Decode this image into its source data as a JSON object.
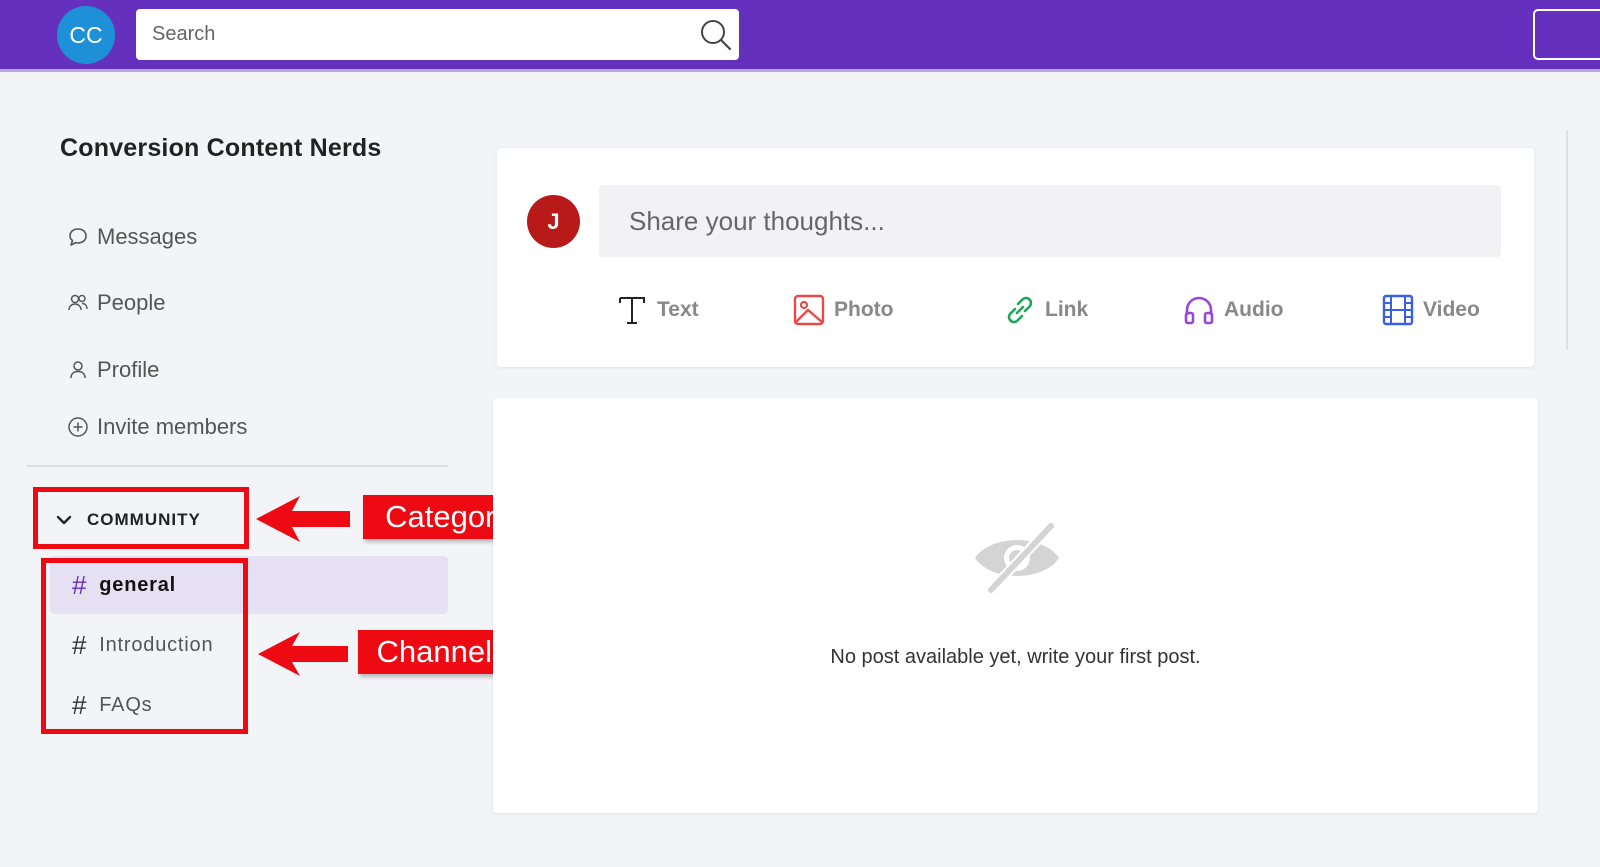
{
  "topbar": {
    "avatar_initials": "CC",
    "search_placeholder": "Search"
  },
  "sidebar": {
    "community_name": "Conversion Content Nerds",
    "nav": [
      {
        "label": "Messages",
        "icon": "chat-bubble-icon"
      },
      {
        "label": "People",
        "icon": "people-icon"
      },
      {
        "label": "Profile",
        "icon": "person-icon"
      },
      {
        "label": "Invite members",
        "icon": "plus-circle-icon"
      }
    ],
    "category": {
      "label": "COMMUNITY",
      "icon": "chevron-down-icon"
    },
    "channels": [
      {
        "label": "general",
        "active": true
      },
      {
        "label": "Introduction",
        "active": false
      },
      {
        "label": "FAQs",
        "active": false
      }
    ]
  },
  "annotations": {
    "category_label": "Category",
    "channels_label": "Channels",
    "color": "#ee0a12"
  },
  "composer": {
    "avatar_initial": "J",
    "placeholder": "Share your thoughts...",
    "post_types": [
      {
        "label": "Text",
        "icon": "text-t-icon",
        "color": "#222222"
      },
      {
        "label": "Photo",
        "icon": "image-icon",
        "color": "#e84a4a"
      },
      {
        "label": "Link",
        "icon": "link-icon",
        "color": "#22a55a"
      },
      {
        "label": "Audio",
        "icon": "headphones-icon",
        "color": "#9b45d8"
      },
      {
        "label": "Video",
        "icon": "film-icon",
        "color": "#3a5fe0"
      }
    ]
  },
  "feed": {
    "empty_icon": "eye-off-icon",
    "empty_message": "No post available yet, write your first post."
  },
  "colors": {
    "brand": "#6530be",
    "avatar_cc": "#1e90d8",
    "avatar_j": "#b81a1a",
    "active_channel_bg": "#e6e1f2"
  }
}
